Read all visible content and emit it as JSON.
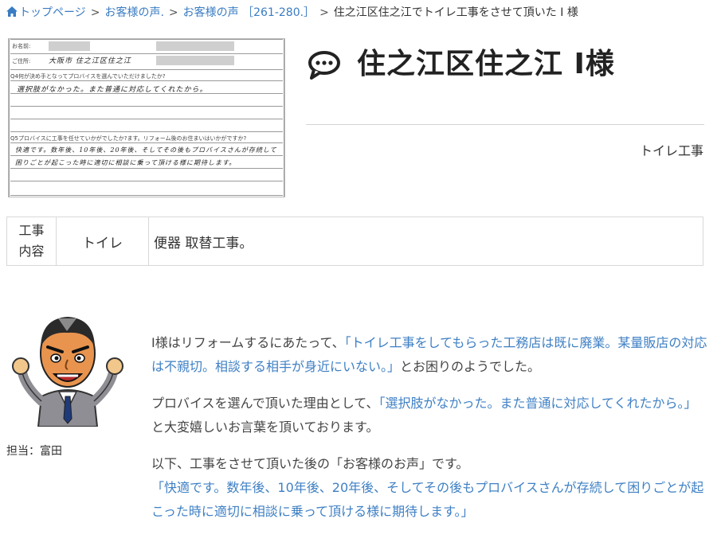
{
  "breadcrumb": {
    "home": "トップページ",
    "voice_list": "お客様の声.",
    "voice_range": "お客様の声 ［261-280.］",
    "current": "住之江区住之江でトイレ工事をさせて頂いた I 様"
  },
  "scan": {
    "name_label": "お名前:",
    "address_label": "ご住所:",
    "address_hand": "大阪市 住之江区住之江",
    "q4": "Q4何が決め手となってプロバイスを選んでいただけましたか?",
    "q4_answer": "選択肢がなかった。また普通に対応してくれたから。",
    "q5": "Q5プロバイスに工事を任せていかがでしたか?ます。リフォーム後のお住まいはいかがですか?",
    "q5_answer_1": "快適です。数年後、10年後、20年後、そしてその後もプロバイスさんが存続して",
    "q5_answer_2": "困りごとが起こった時に適切に相談に乗って頂ける様に期待します。"
  },
  "title": "住之江区住之江 I様",
  "category": "トイレ工事",
  "info": {
    "label": "工事内容",
    "label_line1": "工事",
    "label_line2": "内容",
    "type": "トイレ",
    "detail": "便器 取替工事。"
  },
  "staff": "担当：富田",
  "story": {
    "p1_pre": "I様はリフォームするにあたって、",
    "p1_quote": "「トイレ工事をしてもらった工務店は既に廃業。某量販店の対応は不親切。相談する相手が身近にいない。」",
    "p1_post": "とお困りのようでした。",
    "p2_pre": "プロバイスを選んで頂いた理由として、",
    "p2_quote": "「選択肢がなかった。また普通に対応してくれたから。」",
    "p2_post": "と大変嬉しいお言葉を頂いております。",
    "p3_lead": "以下、工事をさせて頂いた後の「お客様のお声」です。",
    "p3_quote": "「快適です。数年後、10年後、20年後、そしてその後もプロバイスさんが存続して困りごとが起こった時に適切に相談に乗って頂ける様に期待します。」"
  },
  "colors": {
    "link": "#3a7cc2",
    "quote": "#3f80c4",
    "text": "#333333",
    "border": "#d8d8d8"
  }
}
